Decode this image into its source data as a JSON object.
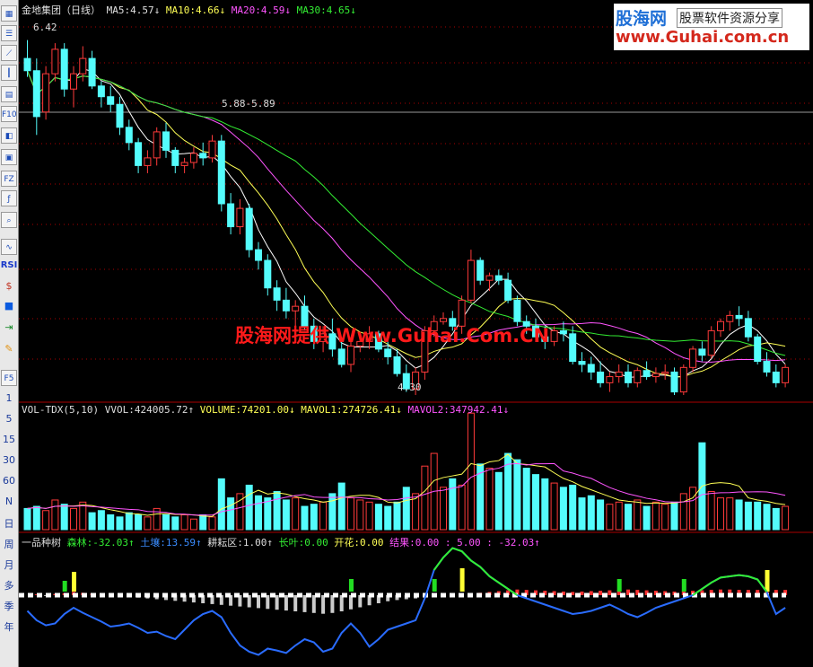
{
  "sidebar": {
    "icons": [
      "grid-icon",
      "list-icon",
      "line-chart-icon",
      "candle-icon",
      "bars-icon",
      "f10-icon",
      "fa-icon",
      "fundamentals-icon",
      "fz-icon",
      "formula-icon",
      "search-icon",
      "wave-icon"
    ],
    "f10_label": "F10",
    "fz_label": "FZ",
    "rsi_label": "RSI",
    "f5_label": "F5",
    "periods": [
      "1",
      "5",
      "15",
      "30",
      "60",
      "N",
      "日",
      "周",
      "月",
      "多",
      "季",
      "年"
    ]
  },
  "main_header": {
    "title": "金地集团（日线）",
    "ma5_label": "MA5:",
    "ma5_value": "4.57↓",
    "ma10_label": "MA10:",
    "ma10_value": "4.66↓",
    "ma20_label": "MA20:",
    "ma20_value": "4.59↓",
    "ma30_label": "MA30:",
    "ma30_value": "4.65↓"
  },
  "logo": {
    "name": "股海网",
    "sub": "股票软件资源分享",
    "url": "www.Guhai.com.cn"
  },
  "watermark": "股海网提供 Www.Guhai.Com.CN",
  "annotations": {
    "high": "6.42",
    "range": "5.88-5.89",
    "low": "4.30"
  },
  "vol_header": {
    "name": "VOL-TDX(5,10)",
    "vvol_label": "VVOL:",
    "vvol_value": "424005.72↑",
    "volume_label": "VOLUME:",
    "volume_value": "74201.00↓",
    "mavol1_label": "MAVOL1:",
    "mavol1_value": "274726.41↓",
    "mavol2_label": "MAVOL2:",
    "mavol2_value": "347942.41↓"
  },
  "ind_header": {
    "name": "一品种树",
    "senlin_label": "森林:",
    "senlin_value": "-32.03↑",
    "turang_label": "土壤:",
    "turang_value": "13.59↑",
    "gengyun_label": "耕耘区:",
    "gengyun_value": "1.00↑",
    "zhangye_label": "长叶:",
    "zhangye_value": "0.00",
    "kaihua_label": "开花:",
    "kaihua_value": "0.00",
    "jieguo_label": "结果:",
    "jieguo_value": "0.00 : 5.00 : -32.03↑"
  },
  "colors": {
    "up": "#ff3a3a",
    "down": "#54fcfc",
    "ma5": "#ffffff",
    "ma10": "#ffff55",
    "ma20": "#ff55ff",
    "ma30": "#33ee33",
    "grid": "#aa0000",
    "blue": "#2a6cff"
  },
  "chart_data": {
    "type": "candlestick",
    "price_axis": [
      4.1,
      6.6
    ],
    "candles": [
      [
        6.3,
        6.42,
        6.18,
        6.22
      ],
      [
        6.22,
        6.3,
        5.8,
        5.92
      ],
      [
        5.95,
        6.25,
        5.9,
        6.2
      ],
      [
        6.2,
        6.4,
        6.15,
        6.36
      ],
      [
        6.36,
        6.4,
        6.05,
        6.1
      ],
      [
        6.1,
        6.25,
        5.98,
        6.2
      ],
      [
        6.2,
        6.38,
        6.15,
        6.3
      ],
      [
        6.3,
        6.35,
        6.1,
        6.12
      ],
      [
        6.12,
        6.15,
        5.98,
        6.05
      ],
      [
        6.05,
        6.12,
        5.95,
        6.0
      ],
      [
        6.0,
        6.05,
        5.8,
        5.85
      ],
      [
        5.85,
        5.9,
        5.7,
        5.75
      ],
      [
        5.75,
        5.78,
        5.55,
        5.6
      ],
      [
        5.6,
        5.7,
        5.55,
        5.65
      ],
      [
        5.65,
        5.85,
        5.6,
        5.82
      ],
      [
        5.82,
        5.88,
        5.65,
        5.7
      ],
      [
        5.7,
        5.72,
        5.55,
        5.6
      ],
      [
        5.6,
        5.65,
        5.55,
        5.62
      ],
      [
        5.62,
        5.72,
        5.58,
        5.68
      ],
      [
        5.68,
        5.75,
        5.6,
        5.65
      ],
      [
        5.65,
        5.8,
        5.62,
        5.76
      ],
      [
        5.76,
        5.8,
        5.3,
        5.35
      ],
      [
        5.35,
        5.42,
        5.15,
        5.2
      ],
      [
        5.2,
        5.38,
        5.15,
        5.32
      ],
      [
        5.32,
        5.35,
        5.0,
        5.05
      ],
      [
        5.05,
        5.1,
        4.92,
        4.98
      ],
      [
        4.98,
        5.02,
        4.75,
        4.8
      ],
      [
        4.8,
        4.85,
        4.65,
        4.72
      ],
      [
        4.72,
        4.8,
        4.6,
        4.65
      ],
      [
        4.65,
        4.72,
        4.55,
        4.68
      ],
      [
        4.68,
        4.75,
        4.52,
        4.55
      ],
      [
        4.55,
        4.6,
        4.4,
        4.45
      ],
      [
        4.45,
        4.55,
        4.38,
        4.5
      ],
      [
        4.5,
        4.6,
        4.35,
        4.4
      ],
      [
        4.4,
        4.45,
        4.28,
        4.3
      ],
      [
        4.3,
        4.48,
        4.25,
        4.42
      ],
      [
        4.42,
        4.5,
        4.38,
        4.45
      ],
      [
        4.45,
        4.55,
        4.4,
        4.5
      ],
      [
        4.5,
        4.52,
        4.38,
        4.4
      ],
      [
        4.4,
        4.45,
        4.3,
        4.35
      ],
      [
        4.35,
        4.4,
        4.22,
        4.24
      ],
      [
        4.24,
        4.3,
        4.12,
        4.14
      ],
      [
        4.14,
        4.28,
        4.1,
        4.25
      ],
      [
        4.25,
        4.55,
        4.2,
        4.52
      ],
      [
        4.52,
        4.62,
        4.48,
        4.58
      ],
      [
        4.58,
        4.64,
        4.56,
        4.6
      ],
      [
        4.6,
        4.65,
        4.52,
        4.55
      ],
      [
        4.55,
        4.75,
        4.5,
        4.72
      ],
      [
        4.72,
        5.05,
        4.7,
        4.98
      ],
      [
        4.98,
        5.0,
        4.82,
        4.85
      ],
      [
        4.85,
        4.9,
        4.78,
        4.88
      ],
      [
        4.88,
        4.92,
        4.82,
        4.85
      ],
      [
        4.85,
        4.9,
        4.7,
        4.72
      ],
      [
        4.72,
        4.75,
        4.55,
        4.58
      ],
      [
        4.58,
        4.62,
        4.5,
        4.55
      ],
      [
        4.55,
        4.6,
        4.45,
        4.48
      ],
      [
        4.48,
        4.55,
        4.4,
        4.45
      ],
      [
        4.45,
        4.55,
        4.42,
        4.52
      ],
      [
        4.52,
        4.58,
        4.45,
        4.5
      ],
      [
        4.5,
        4.55,
        4.3,
        4.32
      ],
      [
        4.32,
        4.38,
        4.25,
        4.3
      ],
      [
        4.3,
        4.35,
        4.2,
        4.25
      ],
      [
        4.25,
        4.32,
        4.15,
        4.18
      ],
      [
        4.18,
        4.25,
        4.12,
        4.22
      ],
      [
        4.22,
        4.3,
        4.18,
        4.25
      ],
      [
        4.25,
        4.3,
        4.15,
        4.18
      ],
      [
        4.18,
        4.28,
        4.15,
        4.26
      ],
      [
        4.26,
        4.32,
        4.2,
        4.22
      ],
      [
        4.22,
        4.28,
        4.18,
        4.24
      ],
      [
        4.24,
        4.3,
        4.2,
        4.25
      ],
      [
        4.25,
        4.28,
        4.1,
        4.12
      ],
      [
        4.12,
        4.3,
        4.1,
        4.28
      ],
      [
        4.28,
        4.42,
        4.25,
        4.4
      ],
      [
        4.4,
        4.45,
        4.32,
        4.36
      ],
      [
        4.36,
        4.55,
        4.34,
        4.52
      ],
      [
        4.52,
        4.6,
        4.48,
        4.58
      ],
      [
        4.58,
        4.65,
        4.52,
        4.62
      ],
      [
        4.62,
        4.68,
        4.55,
        4.6
      ],
      [
        4.6,
        4.65,
        4.45,
        4.48
      ],
      [
        4.48,
        4.5,
        4.3,
        4.32
      ],
      [
        4.32,
        4.38,
        4.22,
        4.25
      ],
      [
        4.25,
        4.3,
        4.15,
        4.18
      ],
      [
        4.18,
        4.3,
        4.15,
        4.28
      ]
    ],
    "volumes": [
      20,
      22,
      18,
      28,
      24,
      20,
      26,
      16,
      18,
      14,
      12,
      16,
      14,
      12,
      20,
      14,
      12,
      14,
      10,
      14,
      12,
      48,
      30,
      34,
      42,
      32,
      30,
      36,
      28,
      30,
      22,
      24,
      26,
      34,
      44,
      30,
      28,
      26,
      24,
      22,
      26,
      40,
      34,
      60,
      72,
      40,
      48,
      42,
      110,
      62,
      58,
      54,
      72,
      66,
      58,
      52,
      48,
      44,
      40,
      42,
      30,
      32,
      28,
      24,
      26,
      24,
      28,
      22,
      26,
      24,
      26,
      34,
      40,
      82,
      36,
      30,
      30,
      28,
      26,
      26,
      24,
      20,
      22
    ],
    "senlin": [
      -25,
      -40,
      -48,
      -45,
      -30,
      -20,
      -28,
      -35,
      -42,
      -50,
      -48,
      -45,
      -52,
      -60,
      -58,
      -65,
      -70,
      -55,
      -40,
      -30,
      -25,
      -35,
      -60,
      -80,
      -90,
      -95,
      -85,
      -88,
      -92,
      -80,
      -70,
      -75,
      -90,
      -85,
      -60,
      -45,
      -60,
      -82,
      -70,
      -55,
      -50,
      -45,
      -40,
      -5,
      40,
      60,
      75,
      70,
      55,
      45,
      30,
      20,
      10,
      0,
      -5,
      -10,
      -15,
      -20,
      -25,
      -30,
      -28,
      -25,
      -20,
      -15,
      -22,
      -30,
      -35,
      -28,
      -20,
      -15,
      -10,
      -5,
      0,
      10,
      20,
      28,
      30,
      32,
      30,
      25,
      5,
      -30,
      -20
    ],
    "turang": [
      0,
      2,
      -2,
      3,
      5,
      8,
      6,
      4,
      2,
      0,
      -2,
      -4,
      -6,
      -8,
      -10,
      -12,
      -14,
      -16,
      -18,
      -20,
      -22,
      -24,
      -26,
      -28,
      -30,
      -32,
      -34,
      -36,
      -38,
      -40,
      -42,
      -44,
      -46,
      -44,
      -40,
      -35,
      -30,
      -25,
      -20,
      -15,
      -12,
      -10,
      -8,
      -6,
      -4,
      -2,
      0,
      2,
      4,
      6,
      8,
      10,
      12,
      14,
      13,
      12,
      11,
      10,
      9,
      8,
      9,
      10,
      11,
      12,
      13,
      14,
      13,
      12,
      11,
      10,
      9,
      10,
      11,
      12,
      13,
      14,
      14,
      13,
      13,
      13,
      13,
      13,
      13
    ],
    "signal_bars": [
      {
        "i": 4,
        "h": 12,
        "c": "#22dd22"
      },
      {
        "i": 5,
        "h": 22,
        "c": "#ffff33"
      },
      {
        "i": 35,
        "h": 14,
        "c": "#22dd22"
      },
      {
        "i": 44,
        "h": 14,
        "c": "#22dd22"
      },
      {
        "i": 47,
        "h": 26,
        "c": "#ffff33"
      },
      {
        "i": 64,
        "h": 14,
        "c": "#22dd22"
      },
      {
        "i": 71,
        "h": 14,
        "c": "#22dd22"
      },
      {
        "i": 80,
        "h": 24,
        "c": "#ffff33"
      }
    ]
  }
}
